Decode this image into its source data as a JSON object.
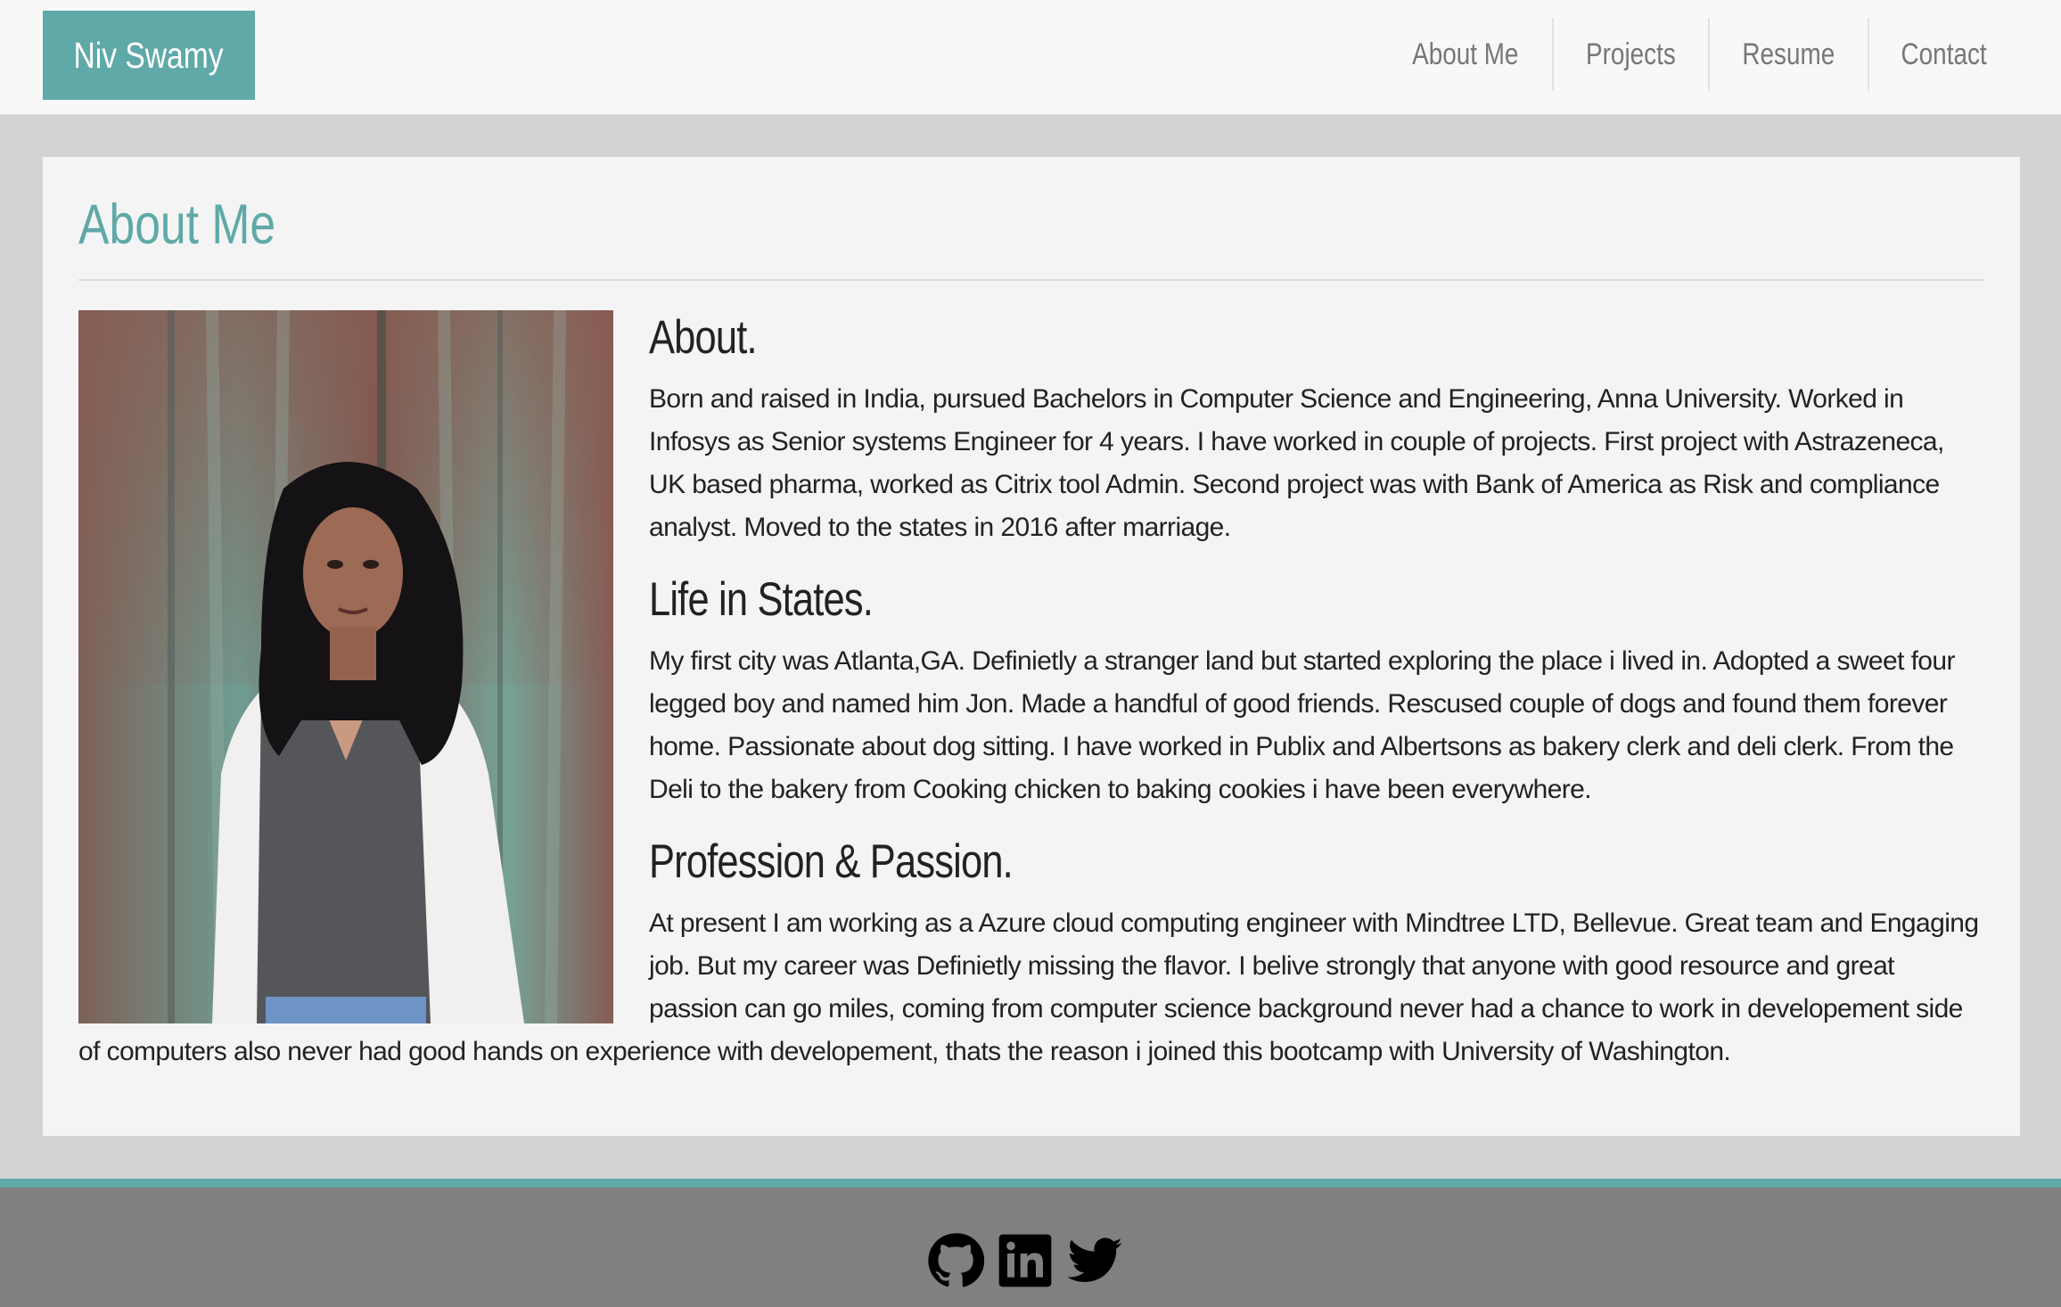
{
  "navbar": {
    "brand": "Niv Swamy",
    "items": [
      {
        "label": "About Me"
      },
      {
        "label": "Projects"
      },
      {
        "label": "Resume"
      },
      {
        "label": "Contact"
      }
    ]
  },
  "main": {
    "title": "About Me",
    "photo_icon": "portrait-photo",
    "sections": [
      {
        "heading": "About.",
        "text": "Born and raised in India, pursued Bachelors in Computer Science and Engineering, Anna University. Worked in Infosys as Senior systems Engineer for 4 years. I have worked in couple of projects. First project with Astrazeneca, UK based pharma, worked as Citrix tool Admin. Second project was with Bank of America as Risk and compliance analyst. Moved to the states in 2016 after marriage."
      },
      {
        "heading": "Life in States.",
        "text": "My first city was Atlanta,GA. Definietly a stranger land but started exploring the place i lived in. Adopted a sweet four legged boy and named him Jon. Made a handful of good friends. Rescused couple of dogs and found them forever home. Passionate about dog sitting. I have worked in Publix and Albertsons as bakery clerk and deli clerk. From the Deli to the bakery from Cooking chicken to baking cookies i have been everywhere."
      },
      {
        "heading": "Profession & Passion.",
        "text": "At present I am working as a Azure cloud computing engineer with Mindtree LTD, Bellevue. Great team and Engaging job. But my career was Definietly missing the flavor. I belive strongly that anyone with good resource and great passion can go miles, coming from computer science background never had a chance to work in developement side of computers also never had good hands on experience with developement, thats the reason i joined this bootcamp with University of Washington."
      }
    ]
  },
  "footer": {
    "icons": [
      "github-icon",
      "linkedin-icon",
      "twitter-icon"
    ],
    "accent_color": "#5fa9a8",
    "background_color": "#808080"
  },
  "colors": {
    "brand": "#5fa9a8",
    "page_background": "#d3d3d3",
    "card_background": "#f4f4f4"
  }
}
